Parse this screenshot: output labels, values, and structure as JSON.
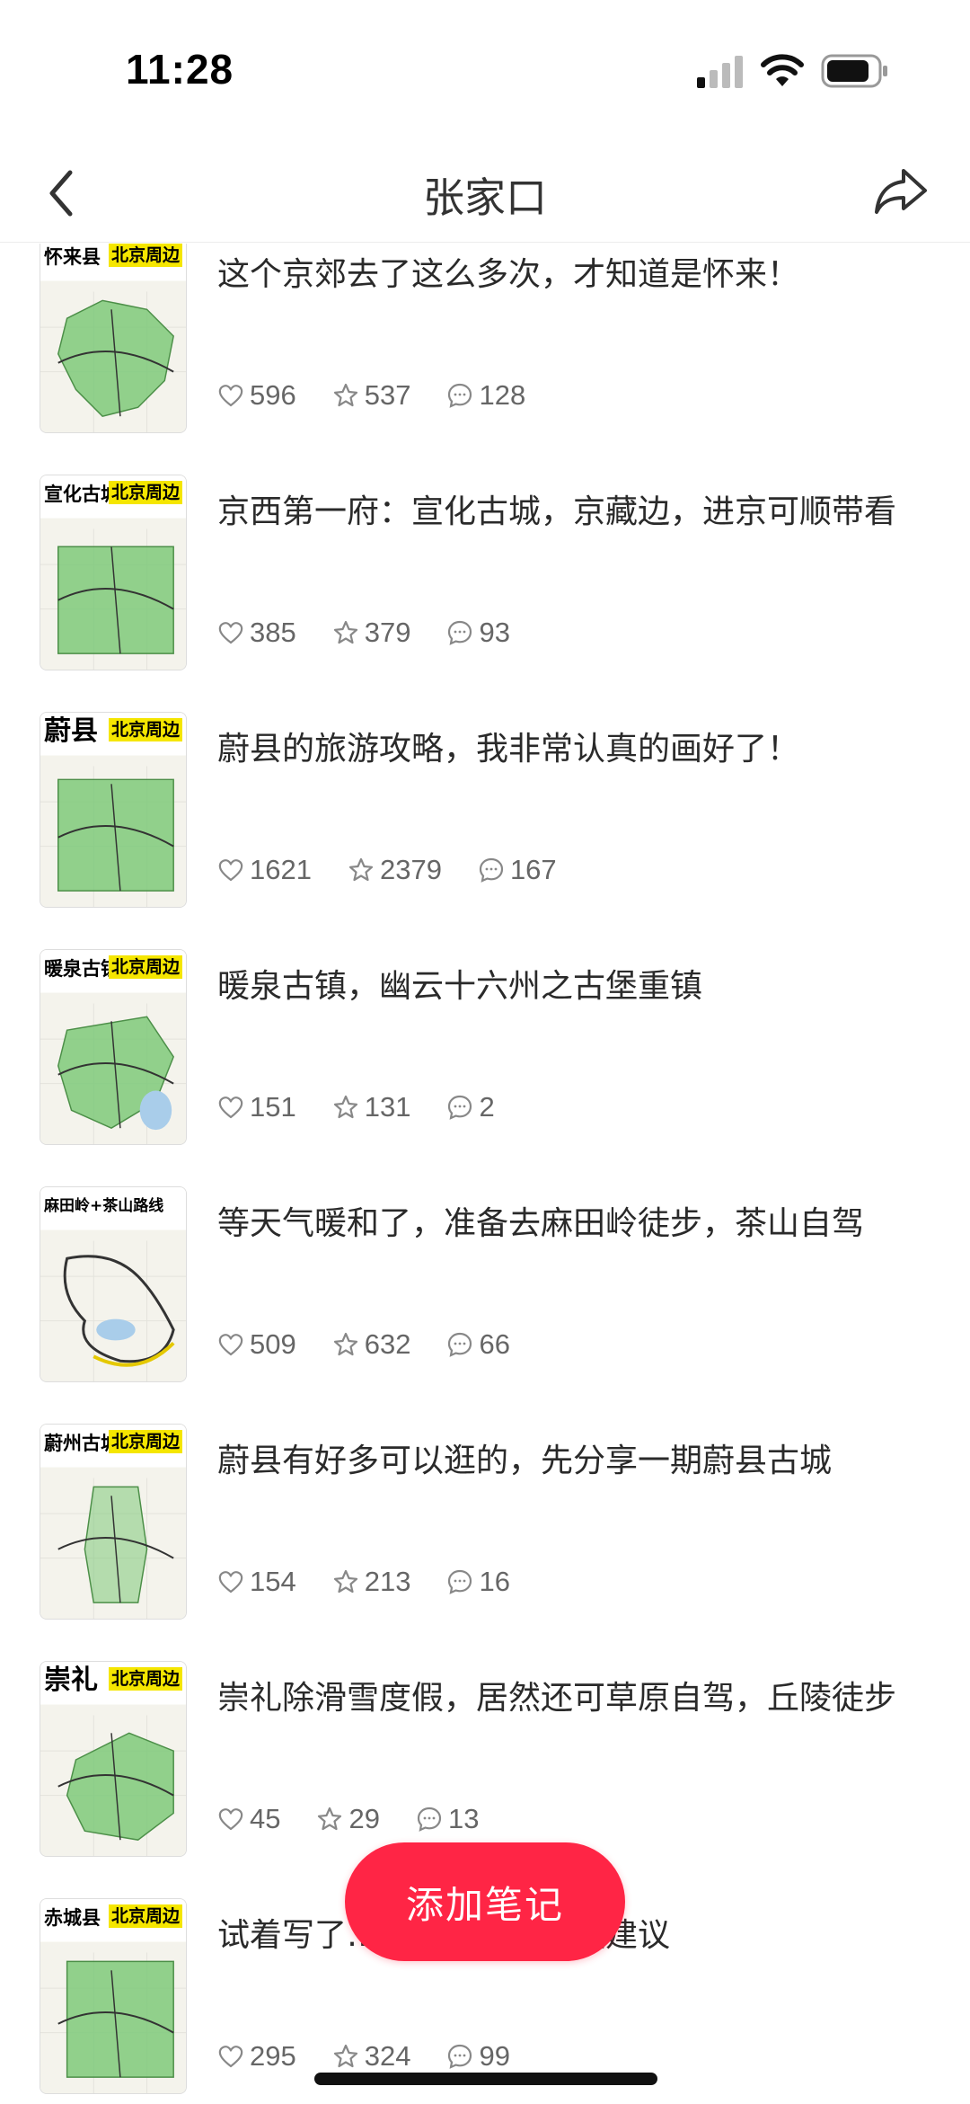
{
  "status_bar": {
    "time": "11:28"
  },
  "nav": {
    "title": "张家口"
  },
  "thumb_colors": {
    "map_green": "#7fc97a",
    "header_yellow": "#f5e600",
    "road": "#333333",
    "water": "#a9cdea"
  },
  "notes": [
    {
      "thumb_label": "怀来县",
      "thumb_tag": "北京周边",
      "title": "这个京郊去了这么多次，才知道是怀来！",
      "likes": "596",
      "stars": "537",
      "comments": "128"
    },
    {
      "thumb_label": "宣化古城",
      "thumb_tag": "北京周边",
      "title": "京西第一府：宣化古城，京藏边，进京可顺带看",
      "likes": "385",
      "stars": "379",
      "comments": "93"
    },
    {
      "thumb_label": "蔚县",
      "thumb_tag": "北京周边",
      "title": "蔚县的旅游攻略，我非常认真的画好了！",
      "likes": "1621",
      "stars": "2379",
      "comments": "167"
    },
    {
      "thumb_label": "暖泉古镇",
      "thumb_tag": "北京周边",
      "title": "暖泉古镇，幽云十六州之古堡重镇",
      "likes": "151",
      "stars": "131",
      "comments": "2"
    },
    {
      "thumb_label": "麻田岭+茶山路线",
      "thumb_tag": "",
      "title": "等天气暖和了，准备去麻田岭徒步，茶山自驾",
      "likes": "509",
      "stars": "632",
      "comments": "66"
    },
    {
      "thumb_label": "蔚州古城",
      "thumb_tag": "北京周边",
      "title": "蔚县有好多可以逛的，先分享一期蔚县古城",
      "likes": "154",
      "stars": "213",
      "comments": "16"
    },
    {
      "thumb_label": "崇礼",
      "thumb_tag": "北京周边",
      "title": "崇礼除滑雪度假，居然还可草原自驾，丘陵徒步",
      "likes": "45",
      "stars": "29",
      "comments": "13"
    },
    {
      "thumb_label": "赤城县",
      "thumb_tag": "北京周边",
      "title": "试着写了…，大家帮看下提建议",
      "likes": "295",
      "stars": "324",
      "comments": "99"
    }
  ],
  "add_note": {
    "label": "添加笔记"
  }
}
